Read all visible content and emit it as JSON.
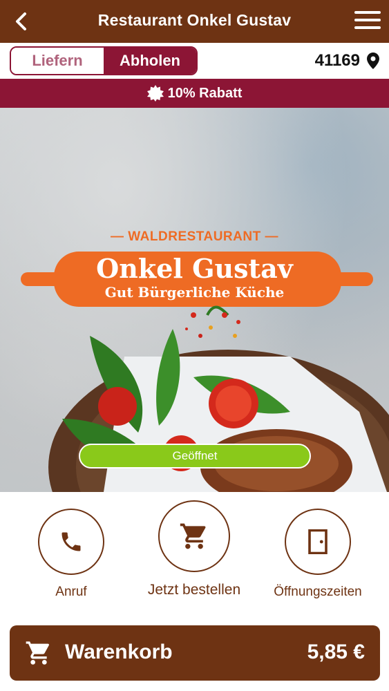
{
  "header": {
    "title": "Restaurant Onkel Gustav",
    "back_icon": "chevron-left-icon",
    "menu_icon": "hamburger-menu-icon"
  },
  "mode_toggle": {
    "options": [
      "Liefern",
      "Abholen"
    ],
    "selected": "Abholen"
  },
  "location": {
    "zip": "41169",
    "icon": "map-pin-icon"
  },
  "promo": {
    "text": "10% Rabatt",
    "icon": "discount-badge-icon"
  },
  "hero": {
    "brand_top": "— WALDRESTAURANT —",
    "brand_name": "Onkel Gustav",
    "brand_subtitle": "Gut Bürgerliche Küche",
    "status": "Geöffnet"
  },
  "actions": [
    {
      "label": "Anruf",
      "icon": "phone-icon"
    },
    {
      "label": "Jetzt bestellen",
      "icon": "shopping-cart-icon"
    },
    {
      "label": "Öffnungszeiten",
      "icon": "door-icon"
    }
  ],
  "cart": {
    "label": "Warenkorb",
    "total": "5,85 €",
    "icon": "shopping-cart-icon"
  },
  "colors": {
    "brown": "#6e3313",
    "burgundy": "#8c1535",
    "orange": "#ee6b24",
    "green": "#8ac91a"
  }
}
